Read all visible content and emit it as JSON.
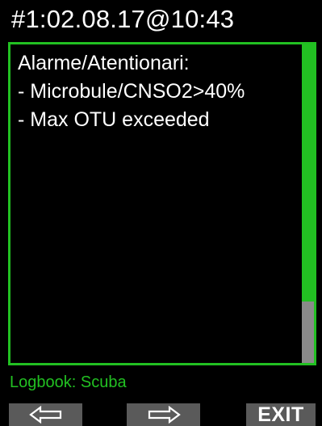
{
  "header": {
    "title": "#1:02.08.17@10:43"
  },
  "alarms": {
    "lines": [
      "Alarme/Atentionari:",
      "- Microbule/CNSO2>40%",
      "- Max OTU exceeded"
    ]
  },
  "footer": {
    "title": "Logbook: Scuba"
  },
  "softkeys": {
    "left_icon": "arrow-left-outline-icon",
    "middle_icon": "arrow-right-outline-icon",
    "right_label": "EXIT"
  },
  "colors": {
    "accent": "#22c022",
    "background": "#000000",
    "softkey": "#5a5a5a",
    "scroll_thumb": "#8a8a8a"
  }
}
